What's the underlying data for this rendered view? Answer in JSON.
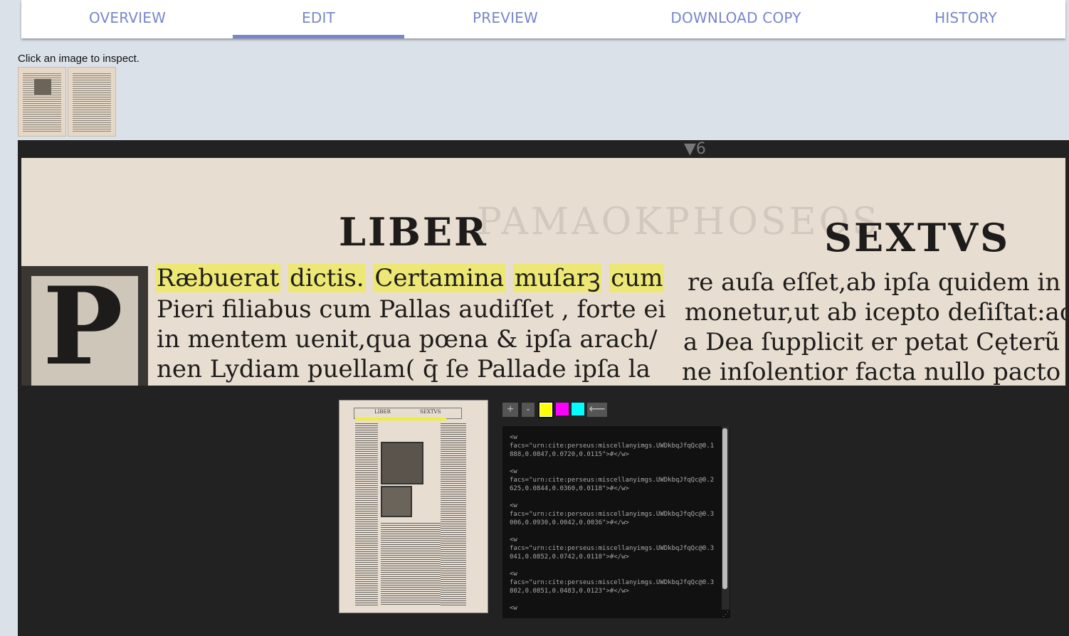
{
  "tabs": [
    {
      "label": "OVERVIEW"
    },
    {
      "label": "EDIT"
    },
    {
      "label": "PREVIEW"
    },
    {
      "label": "DOWNLOAD COPY"
    },
    {
      "label": "HISTORY"
    }
  ],
  "active_tab": "EDIT",
  "hint": "Click an image to inspect.",
  "viewer": {
    "pager": "▼6",
    "crop": {
      "header_left": "LIBER",
      "header_right": "SEXTVS",
      "ghost": "PAMAOKPHOSEOS",
      "initial": "P",
      "highlighted_words": [
        "Ræbuerat",
        "dictis.",
        "Certamina",
        "muſarꝫ",
        "cum"
      ],
      "left_lines": [
        "Pieri filiabus cum Pallas audiſſet , forte ei",
        "in mentem uenit,qua pœna & ipſa arach/",
        "nen Lydiam puellam( q̄ ſe Pallade ipſa la"
      ],
      "right_lines": [
        "re auſa eſſet,ab ipſa quidem in V",
        "monetur,ut ab icepto deſiſtat:ac",
        "a Dea ſupplicit er petat Cęterũ a",
        "ne inſolentior facta nullo pacto"
      ]
    },
    "page_thumb": {
      "head_left": "LIBER",
      "head_right": "SEXTVS"
    },
    "tools": {
      "plus": "+",
      "minus": "-",
      "back": "⟵",
      "swatches": [
        "#ffff00",
        "#ff00ff",
        "#00ffff"
      ],
      "selected_swatch": "#ffff00"
    },
    "xml_text": "<w\nfacs=\"urn:cite:perseus:miscellanyimgs.UWDkbqJfqQc@0.1888,0.0847,0.0720,0.0115\">#</w>\n\n<w\nfacs=\"urn:cite:perseus:miscellanyimgs.UWDkbqJfqQc@0.2625,0.0844,0.0360,0.0118\">#</w>\n\n<w\nfacs=\"urn:cite:perseus:miscellanyimgs.UWDkbqJfqQc@0.3006,0.0930,0.0042,0.0036\">#</w>\n\n<w\nfacs=\"urn:cite:perseus:miscellanyimgs.UWDkbqJfqQc@0.3041,0.0852,0.0742,0.0118\">#</w>\n\n<w\nfacs=\"urn:cite:perseus:miscellanyimgs.UWDkbqJfqQc@0.3802,0.0851,0.0483,0.0123\">#</w>\n\n<w"
  }
}
